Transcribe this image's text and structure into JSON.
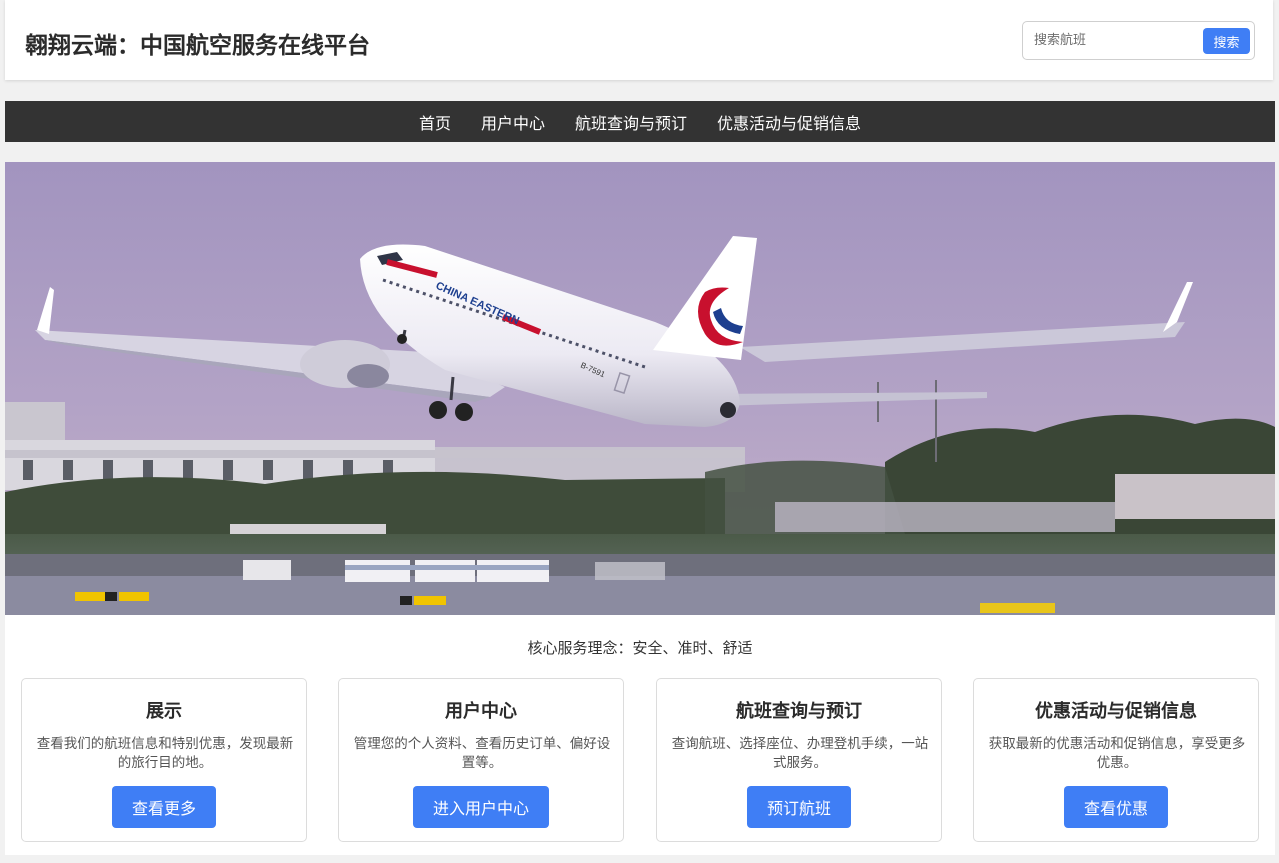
{
  "header": {
    "title": "翱翔云端：中国航空服务在线平台",
    "search": {
      "placeholder": "搜索航班",
      "button_label": "搜索"
    }
  },
  "nav": {
    "items": [
      "首页",
      "用户中心",
      "航班查询与预订",
      "优惠活动与促销信息"
    ]
  },
  "hero": {
    "image": "passenger-jet-takeoff",
    "airline_lettering": "CHINA EASTERN",
    "registration": "B-7591"
  },
  "tagline": "核心服务理念：安全、准时、舒适",
  "cards": [
    {
      "title": "展示",
      "description": "查看我们的航班信息和特别优惠，发现最新的旅行目的地。",
      "button": "查看更多"
    },
    {
      "title": "用户中心",
      "description": "管理您的个人资料、查看历史订单、偏好设置等。",
      "button": "进入用户中心"
    },
    {
      "title": "航班查询与预订",
      "description": "查询航班、选择座位、办理登机手续，一站式服务。",
      "button": "预订航班"
    },
    {
      "title": "优惠活动与促销信息",
      "description": "获取最新的优惠活动和促销信息，享受更多优惠。",
      "button": "查看优惠"
    }
  ],
  "colors": {
    "accent": "#3f7ef5",
    "nav_background": "#333333",
    "page_background": "#f1f1f1",
    "airline_red": "#c8102e",
    "airline_blue": "#1d3f8f"
  }
}
